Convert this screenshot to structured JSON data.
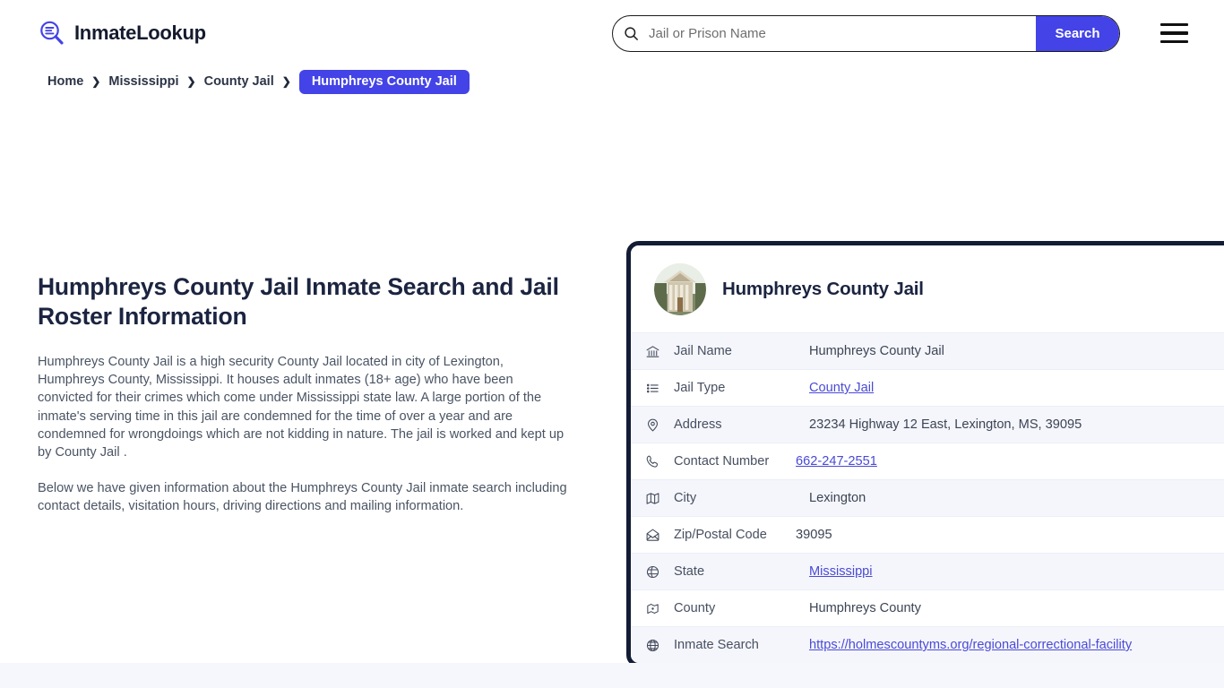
{
  "brand": {
    "name": "InmateLookup",
    "icon": "search-list-icon"
  },
  "search": {
    "placeholder": "Jail or Prison Name",
    "value": "",
    "button_label": "Search",
    "icon": "search-icon",
    "accent_color": "#4343e8"
  },
  "menu": {
    "icon": "hamburger-menu-icon"
  },
  "breadcrumb": {
    "items": [
      {
        "label": "Home",
        "current": false
      },
      {
        "label": "Mississippi",
        "current": false
      },
      {
        "label": "County Jail",
        "current": false
      },
      {
        "label": "Humphreys County Jail",
        "current": true
      }
    ],
    "separator": "❯"
  },
  "article": {
    "title": "Humphreys County Jail Inmate Search and Jail Roster Information",
    "paragraph_1": "Humphreys County Jail is a high security County Jail located in city of Lexington, Humphreys County, Mississippi. It houses adult inmates (18+ age) who have been convicted for their crimes which come under Mississippi state law. A large portion of the inmate's serving time in this jail are condemned for the time of over a year and are condemned for wrongdoings which are not kidding in nature. The jail is worked and kept up by County Jail .",
    "paragraph_2": "Below we have given information about the Humphreys County Jail inmate search including contact details, visitation hours, driving directions and mailing information."
  },
  "card": {
    "title": "Humphreys County Jail",
    "avatar_alt": "courthouse-photo",
    "border_color": "#131c35",
    "rows": [
      {
        "icon": "bank-icon",
        "label": "Jail Name",
        "value": "Humphreys County Jail",
        "link": false
      },
      {
        "icon": "list-icon",
        "label": "Jail Type",
        "value": "County Jail",
        "link": true
      },
      {
        "icon": "map-pin-icon",
        "label": "Address",
        "value": "23234 Highway 12 East, Lexington, MS, 39095",
        "link": false
      },
      {
        "icon": "phone-icon",
        "label": "Contact Number",
        "value": "662-247-2551",
        "link": true
      },
      {
        "icon": "map-icon",
        "label": "City",
        "value": "Lexington",
        "link": false
      },
      {
        "icon": "envelope-icon",
        "label": "Zip/Postal Code",
        "value": "39095",
        "link": false
      },
      {
        "icon": "globe-pin-icon",
        "label": "State",
        "value": "Mississippi",
        "link": true
      },
      {
        "icon": "county-icon",
        "label": "County",
        "value": "Humphreys County",
        "link": false
      },
      {
        "icon": "globe-icon",
        "label": "Inmate Search",
        "value": "https://holmescountyms.org/regional-correctional-facility",
        "link": true
      }
    ]
  }
}
